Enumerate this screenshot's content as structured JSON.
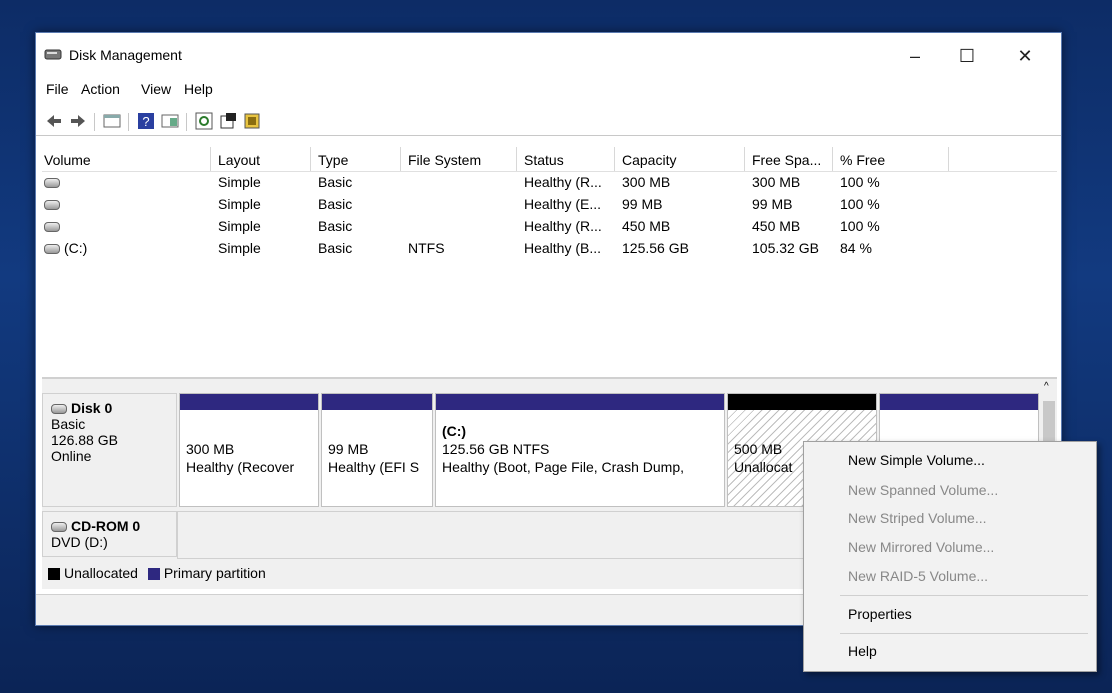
{
  "window": {
    "title": "Disk Management"
  },
  "menu": [
    "File",
    "Action",
    "View",
    "Help"
  ],
  "columns": [
    "Volume",
    "Layout",
    "Type",
    "File System",
    "Status",
    "Capacity",
    "Free Spa...",
    "% Free"
  ],
  "volumes": [
    [
      "",
      "Simple",
      "Basic",
      "",
      "Healthy (R...",
      "300 MB",
      "300 MB",
      "100 %"
    ],
    [
      "",
      "Simple",
      "Basic",
      "",
      "Healthy (E...",
      "99 MB",
      "99 MB",
      "100 %"
    ],
    [
      "",
      "Simple",
      "Basic",
      "",
      "Healthy (R...",
      "450 MB",
      "450 MB",
      "100 %"
    ],
    [
      "(C:)",
      "Simple",
      "Basic",
      "NTFS",
      "Healthy (B...",
      "125.56 GB",
      "105.32 GB",
      "84 %"
    ]
  ],
  "disk0": {
    "name": "Disk 0",
    "type": "Basic",
    "size": "126.88 GB",
    "status": "Online",
    "partitions": [
      {
        "title": "",
        "size": "300 MB",
        "status": "Healthy (Recover"
      },
      {
        "title": "",
        "size": "99 MB",
        "status": "Healthy (EFI S"
      },
      {
        "title": "(C:)",
        "size": "125.56 GB NTFS",
        "status": "Healthy (Boot, Page File, Crash Dump,"
      },
      {
        "title": "",
        "size": "500 MB",
        "status": "Unallocat"
      }
    ]
  },
  "cdrom": {
    "name": "CD-ROM 0",
    "drive": "DVD (D:)"
  },
  "legend": {
    "unallocated": "Unallocated",
    "primary": "Primary partition"
  },
  "context_menu": {
    "new_simple": "New Simple Volume...",
    "new_spanned": "New Spanned Volume...",
    "new_striped": "New Striped Volume...",
    "new_mirrored": "New Mirrored Volume...",
    "new_raid5": "New RAID-5 Volume...",
    "properties": "Properties",
    "help": "Help"
  },
  "colors": {
    "primary_partition": "#2e2880",
    "unallocated": "#000000",
    "desktop": "#123a80"
  }
}
